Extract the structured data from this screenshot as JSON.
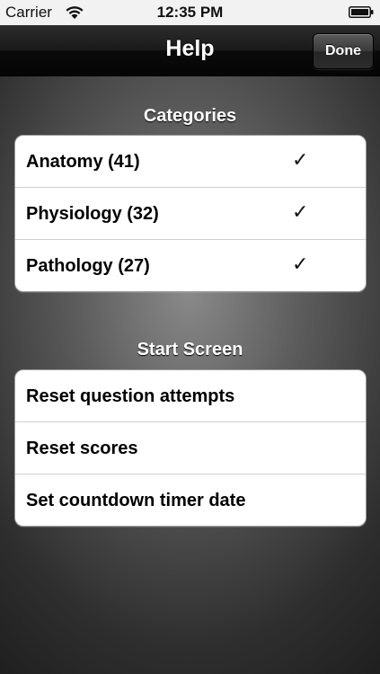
{
  "status_bar": {
    "carrier": "Carrier",
    "time": "12:35 PM",
    "wifi_icon": "wifi-icon",
    "battery_icon": "battery-icon"
  },
  "nav_bar": {
    "title": "Help",
    "done_label": "Done"
  },
  "categories": {
    "header": "Categories",
    "items": [
      {
        "label": "Anatomy (41)",
        "checked": true,
        "check": "✓"
      },
      {
        "label": "Physiology (32)",
        "checked": true,
        "check": "✓"
      },
      {
        "label": "Pathology (27)",
        "checked": true,
        "check": "✓"
      }
    ]
  },
  "start_screen": {
    "header": "Start Screen",
    "items": [
      {
        "label": "Reset question attempts"
      },
      {
        "label": "Reset scores"
      },
      {
        "label": "Set countdown timer date"
      }
    ]
  },
  "colors": {
    "nav_bar": "#111111",
    "background_center": "#8a8a8a",
    "background_edge": "#151515",
    "group_background": "#ffffff"
  }
}
